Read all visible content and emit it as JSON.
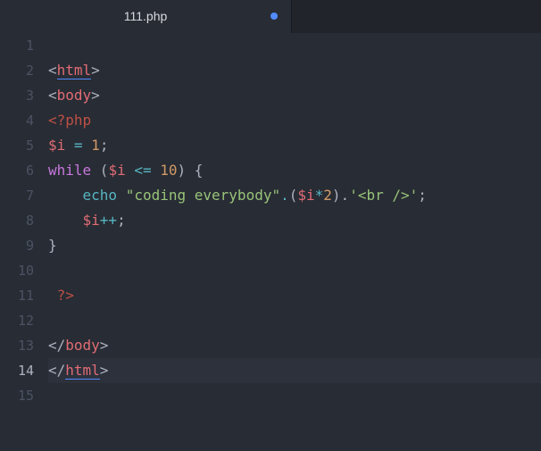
{
  "tab": {
    "title": "111.php",
    "modified": true
  },
  "lines": [
    {
      "n": "1",
      "tokens": []
    },
    {
      "n": "2",
      "tokens": [
        {
          "t": "<",
          "c": "tok-punct"
        },
        {
          "t": "html",
          "c": "tok-tag match"
        },
        {
          "t": ">",
          "c": "tok-punct"
        }
      ]
    },
    {
      "n": "3",
      "tokens": [
        {
          "t": "<",
          "c": "tok-punct"
        },
        {
          "t": "body",
          "c": "tok-tag"
        },
        {
          "t": ">",
          "c": "tok-punct"
        }
      ]
    },
    {
      "n": "4",
      "tokens": [
        {
          "t": "<?php",
          "c": "tok-php"
        }
      ]
    },
    {
      "n": "5",
      "tokens": [
        {
          "t": "$i",
          "c": "tok-var"
        },
        {
          "t": " = ",
          "c": "tok-op"
        },
        {
          "t": "1",
          "c": "tok-num"
        },
        {
          "t": ";",
          "c": "tok-punct"
        }
      ]
    },
    {
      "n": "6",
      "tokens": [
        {
          "t": "while",
          "c": "tok-kw"
        },
        {
          "t": " (",
          "c": "tok-punct"
        },
        {
          "t": "$i",
          "c": "tok-var"
        },
        {
          "t": " <= ",
          "c": "tok-op"
        },
        {
          "t": "10",
          "c": "tok-num"
        },
        {
          "t": ") {",
          "c": "tok-punct"
        }
      ]
    },
    {
      "n": "7",
      "tokens": [
        {
          "t": "    ",
          "c": "tok-punct"
        },
        {
          "t": "echo",
          "c": "tok-fn"
        },
        {
          "t": " ",
          "c": "tok-punct"
        },
        {
          "t": "\"coding everybody\"",
          "c": "tok-str"
        },
        {
          "t": ".",
          "c": "tok-op"
        },
        {
          "t": "(",
          "c": "tok-punct"
        },
        {
          "t": "$i",
          "c": "tok-var"
        },
        {
          "t": "*",
          "c": "tok-op"
        },
        {
          "t": "2",
          "c": "tok-num"
        },
        {
          "t": ").",
          "c": "tok-punct"
        },
        {
          "t": "'<br />'",
          "c": "tok-str"
        },
        {
          "t": ";",
          "c": "tok-punct"
        }
      ]
    },
    {
      "n": "8",
      "tokens": [
        {
          "t": "    ",
          "c": "tok-punct"
        },
        {
          "t": "$i",
          "c": "tok-var"
        },
        {
          "t": "++",
          "c": "tok-op"
        },
        {
          "t": ";",
          "c": "tok-punct"
        }
      ]
    },
    {
      "n": "9",
      "tokens": [
        {
          "t": "}",
          "c": "tok-punct"
        }
      ]
    },
    {
      "n": "10",
      "tokens": []
    },
    {
      "n": "11",
      "tokens": [
        {
          "t": " ?>",
          "c": "tok-php"
        }
      ]
    },
    {
      "n": "12",
      "tokens": []
    },
    {
      "n": "13",
      "tokens": [
        {
          "t": "</",
          "c": "tok-punct"
        },
        {
          "t": "body",
          "c": "tok-tag"
        },
        {
          "t": ">",
          "c": "tok-punct"
        }
      ]
    },
    {
      "n": "14",
      "tokens": [
        {
          "t": "</",
          "c": "tok-punct"
        },
        {
          "t": "html",
          "c": "tok-tag match"
        },
        {
          "t": ">",
          "c": "tok-punct"
        }
      ],
      "current": true
    },
    {
      "n": "15",
      "tokens": []
    }
  ]
}
